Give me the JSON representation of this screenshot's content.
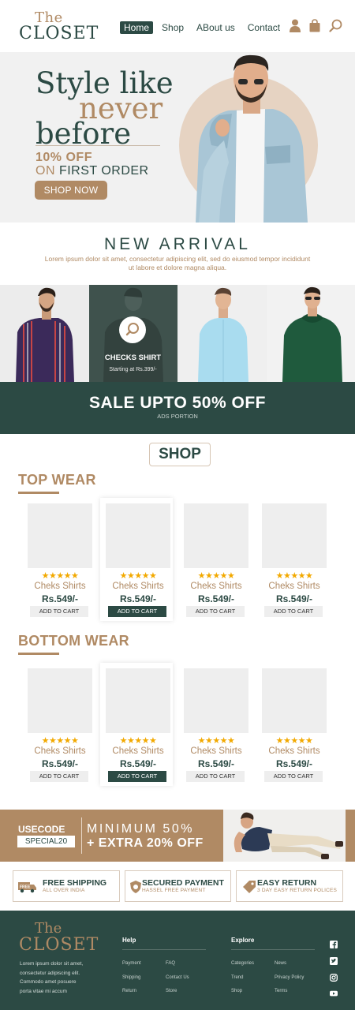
{
  "header": {
    "logo_top": "The",
    "logo_bottom": "CLOSET",
    "nav": [
      "Home",
      "Shop",
      "ABout us",
      "Contact"
    ]
  },
  "hero": {
    "title_line1": "Style like",
    "title_line2": "never",
    "title_line3": "before",
    "offer_line1": "10% OFF",
    "offer_on": "ON",
    "offer_line2": "FIRST ORDER",
    "cta": "SHOP NOW"
  },
  "new_arrival": {
    "title": "NEW ARRIVAL",
    "description": "Lorem ipsum dolor sit amet, consectetur adipiscing elit, sed do eiusmod tempor incididunt ut labore et dolore magna aliqua.",
    "overlay_name": "CHECKS SHIRT",
    "overlay_price": "Starting at Rs.399/-"
  },
  "sale": {
    "title": "SALE UPTO 50% OFF",
    "subtitle": "ADS PORTION"
  },
  "shop": {
    "label": "SHOP",
    "sections": [
      {
        "title": "TOP WEAR",
        "products": [
          {
            "rating": 5,
            "stars": "★★★★★",
            "name": "Cheks Shirts",
            "price": "Rs.549/-",
            "button": "ADD TO CART"
          },
          {
            "rating": 5,
            "stars": "★★★★★",
            "name": "Cheks Shirts",
            "price": "Rs.549/-",
            "button": "ADD TO CART"
          },
          {
            "rating": 5,
            "stars": "★★★★★",
            "name": "Cheks Shirts",
            "price": "Rs.549/-",
            "button": "ADD TO CART"
          },
          {
            "rating": 5,
            "stars": "★★★★★",
            "name": "Cheks Shirts",
            "price": "Rs.549/-",
            "button": "ADD TO CART"
          }
        ]
      },
      {
        "title": "BOTTOM WEAR",
        "products": [
          {
            "rating": 5,
            "stars": "★★★★★",
            "name": "Cheks Shirts",
            "price": "Rs.549/-",
            "button": "ADD TO CART"
          },
          {
            "rating": 5,
            "stars": "★★★★★",
            "name": "Cheks Shirts",
            "price": "Rs.549/-",
            "button": "ADD TO CART"
          },
          {
            "rating": 5,
            "stars": "★★★★★",
            "name": "Cheks Shirts",
            "price": "Rs.549/-",
            "button": "ADD TO CART"
          },
          {
            "rating": 5,
            "stars": "★★★★★",
            "name": "Cheks Shirts",
            "price": "Rs.549/-",
            "button": "ADD TO CART"
          }
        ]
      }
    ]
  },
  "promo": {
    "usecode": "USECODE",
    "code": "SPECIAL20",
    "line1": "MINIMUM 50%",
    "line2": "+ EXTRA 20% OFF"
  },
  "features": [
    {
      "icon": "truck-icon",
      "badge": "FREE",
      "title": "FREE SHIPPING",
      "subtitle": "ALL OVER INDIA"
    },
    {
      "icon": "shield-icon",
      "title": "SECURED PAYMENT",
      "subtitle": "HASSEL FREE PAYMENT"
    },
    {
      "icon": "return-tag-icon",
      "title": "EASY RETURN",
      "subtitle": "3 DAY EASY RETURN POLICES"
    }
  ],
  "footer": {
    "logo_top": "The",
    "logo_bottom": "CLOSET",
    "description_lines": [
      "Lorem ipsum dolor sit amet,",
      "consectetur adipiscing elit.",
      "Commodo amet posuere",
      "porta vitae mi accum"
    ],
    "help": {
      "title": "Help",
      "links": [
        "Payment",
        "FAQ",
        "Shipping",
        "Contact Us",
        "Return",
        "Store"
      ]
    },
    "explore": {
      "title": "Explore",
      "links": [
        "Categories",
        "News",
        "Trend",
        "Privacy Policy",
        "Shop",
        "Terms"
      ]
    },
    "social": [
      "facebook-icon",
      "twitter-icon",
      "instagram-icon",
      "youtube-icon"
    ]
  },
  "colors": {
    "primary": "#2c4a44",
    "accent": "#b08a64",
    "star": "#f2a900",
    "light_bg": "#eeeeee"
  }
}
